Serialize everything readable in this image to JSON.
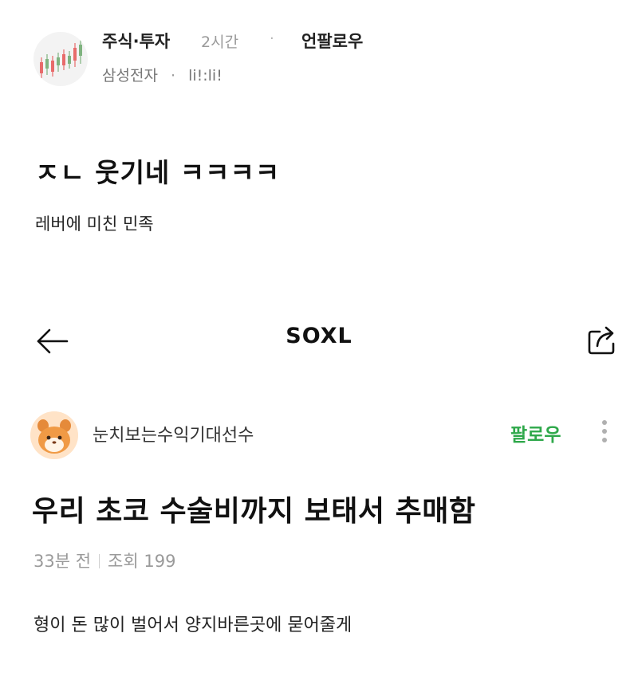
{
  "post": {
    "category": "주식·투자",
    "time": "2시간",
    "separator": "·",
    "unfollow_label": "언팔로우",
    "company": "삼성전자",
    "company_separator": "·",
    "nickname": "li!:li!",
    "title": "ㅈㄴ 웃기네 ㅋㅋㅋㅋ",
    "body": "레버에 미친 민족"
  },
  "embed": {
    "header_title": "SOXL",
    "back_icon": "arrow-left-icon",
    "share_icon": "share-icon",
    "username": "눈치보는수익기대선수",
    "follow_label": "팔로우",
    "title": "우리 초코 수술비까지 보태서 추매함",
    "posted": "33분 전",
    "views": "조회 199",
    "body": "형이 돈 많이 벌어서 양지바른곳에 묻어줄게"
  },
  "colors": {
    "follow_green": "#2ea84a",
    "muted_gray": "#9a9a9a"
  }
}
